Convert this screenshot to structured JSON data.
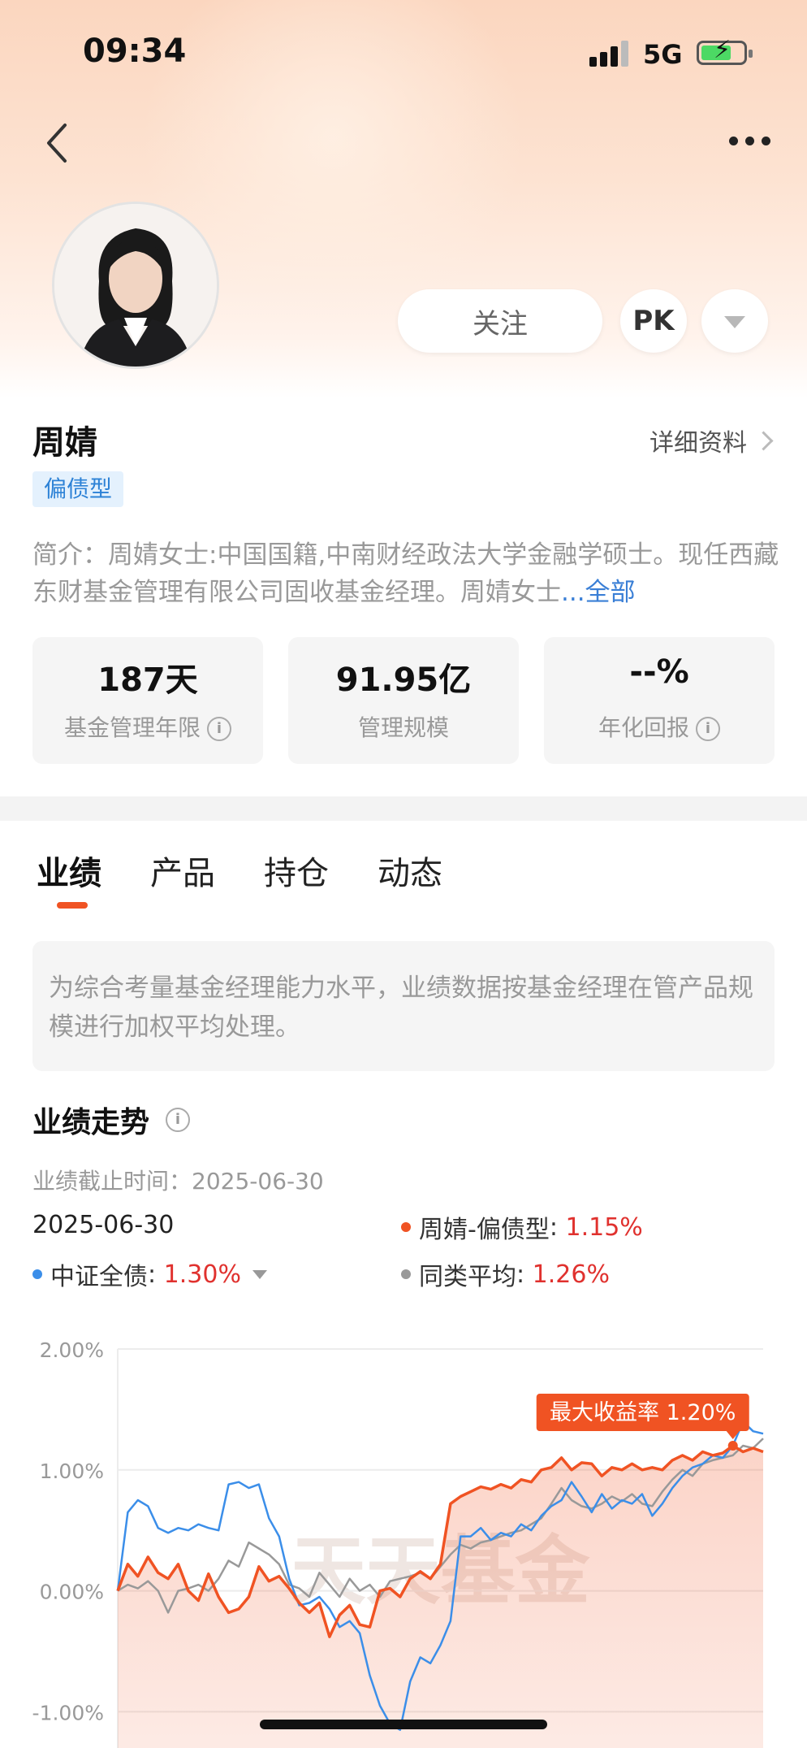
{
  "status_bar": {
    "time": "09:34",
    "network": "5G"
  },
  "profile": {
    "follow_label": "关注",
    "pk_label": "PK",
    "name": "周婧",
    "detail_link": "详细资料",
    "type_tag": "偏债型",
    "intro_text": "简介：周婧女士:中国国籍,中南财经政法大学金融学硕士。现任西藏东财基金管理有限公司固收基金经理。周婧女士",
    "intro_more": "...全部"
  },
  "stats": [
    {
      "value": "187天",
      "label": "基金管理年限"
    },
    {
      "value": "91.95亿",
      "label": "管理规模"
    },
    {
      "value": "--%",
      "label": "年化回报"
    }
  ],
  "tabs": [
    "业绩",
    "产品",
    "持仓",
    "动态"
  ],
  "notice": "为综合考量基金经理能力水平，业绩数据按基金经理在管产品规模进行加权平均处理。",
  "performance": {
    "title": "业绩走势",
    "cutoff_label": "业绩截止时间：",
    "cutoff_date": "2025-06-30",
    "current_date": "2025-06-30",
    "legend": [
      {
        "name": "周婧-偏债型",
        "value": "1.15%",
        "color": "#f05323"
      },
      {
        "name": "中证全债",
        "value": "1.30%",
        "color": "#3b8ee9"
      },
      {
        "name": "同类平均",
        "value": "1.26%",
        "color": "#999999"
      }
    ],
    "colors": {
      "accent": "#f05323",
      "positive": "#e0312e",
      "benchmark": "#3b8ee9",
      "peer": "#999999"
    }
  },
  "chart_data": {
    "type": "line",
    "yticks": [
      "2.00%",
      "1.00%",
      "0.00%",
      "-1.00%"
    ],
    "ylim": [
      -1.3,
      2.0
    ],
    "grid": true,
    "watermark": "天天基金",
    "annotation": "最大收益率 1.20%",
    "series": [
      {
        "name": "周婧-偏债型",
        "color": "#f05323",
        "values": [
          0.0,
          0.22,
          0.12,
          0.28,
          0.15,
          0.1,
          0.22,
          0.0,
          -0.08,
          0.14,
          -0.05,
          -0.18,
          -0.15,
          -0.05,
          0.2,
          0.08,
          0.12,
          0.02,
          -0.1,
          -0.18,
          -0.1,
          -0.38,
          -0.2,
          -0.12,
          -0.28,
          -0.3,
          0.0,
          0.02,
          -0.05,
          0.1,
          0.16,
          0.1,
          0.22,
          0.72,
          0.78,
          0.82,
          0.86,
          0.84,
          0.88,
          0.85,
          0.92,
          0.9,
          1.0,
          1.02,
          1.1,
          1.0,
          1.06,
          1.05,
          0.95,
          1.02,
          1.0,
          1.05,
          1.0,
          1.02,
          1.0,
          1.08,
          1.12,
          1.08,
          1.15,
          1.12,
          1.14,
          1.2,
          1.15,
          1.18,
          1.15
        ]
      },
      {
        "name": "中证全债",
        "color": "#3b8ee9",
        "values": [
          0.0,
          0.65,
          0.75,
          0.7,
          0.52,
          0.48,
          0.52,
          0.5,
          0.55,
          0.52,
          0.5,
          0.88,
          0.9,
          0.85,
          0.88,
          0.6,
          0.45,
          0.1,
          -0.12,
          -0.1,
          -0.05,
          -0.15,
          -0.3,
          -0.25,
          -0.35,
          -0.7,
          -0.95,
          -1.1,
          -1.15,
          -0.75,
          -0.55,
          -0.6,
          -0.45,
          -0.25,
          0.45,
          0.45,
          0.52,
          0.42,
          0.48,
          0.45,
          0.55,
          0.5,
          0.62,
          0.7,
          0.75,
          0.9,
          0.78,
          0.65,
          0.8,
          0.68,
          0.75,
          0.72,
          0.8,
          0.62,
          0.72,
          0.85,
          0.95,
          1.02,
          1.05,
          1.12,
          1.1,
          1.2,
          1.4,
          1.32,
          1.3
        ]
      },
      {
        "name": "同类平均",
        "color": "#999999",
        "values": [
          0.0,
          0.05,
          0.02,
          0.08,
          0.0,
          -0.18,
          0.0,
          0.02,
          0.05,
          0.0,
          0.1,
          0.25,
          0.2,
          0.4,
          0.35,
          0.3,
          0.22,
          0.05,
          0.02,
          -0.05,
          0.15,
          0.05,
          -0.05,
          0.1,
          0.0,
          0.05,
          -0.05,
          0.08,
          0.1,
          0.12,
          0.15,
          0.1,
          0.2,
          0.3,
          0.38,
          0.35,
          0.4,
          0.42,
          0.45,
          0.48,
          0.5,
          0.55,
          0.6,
          0.72,
          0.85,
          0.75,
          0.7,
          0.68,
          0.72,
          0.78,
          0.74,
          0.8,
          0.72,
          0.7,
          0.82,
          0.92,
          1.0,
          0.95,
          1.05,
          1.08,
          1.1,
          1.12,
          1.2,
          1.18,
          1.26
        ]
      }
    ]
  }
}
